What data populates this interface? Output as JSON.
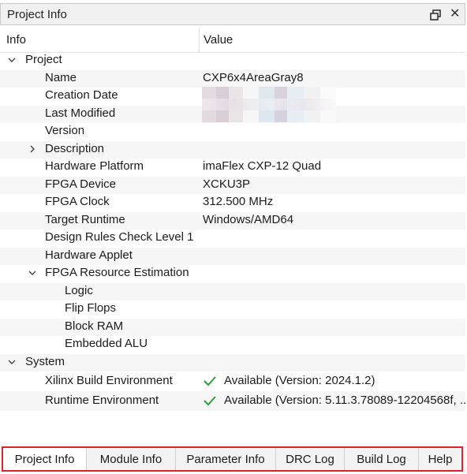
{
  "panel": {
    "title": "Project Info"
  },
  "header": {
    "info_label": "Info",
    "value_label": "Value"
  },
  "tree": {
    "project_label": "Project",
    "name": {
      "label": "Name",
      "value": "CXP6x4AreaGray8"
    },
    "creation_date": {
      "label": "Creation Date"
    },
    "last_modified": {
      "label": "Last Modified"
    },
    "version": {
      "label": "Version"
    },
    "description": {
      "label": "Description"
    },
    "hardware_platform": {
      "label": "Hardware Platform",
      "value": "imaFlex CXP-12 Quad"
    },
    "fpga_device": {
      "label": "FPGA Device",
      "value": "XCKU3P"
    },
    "fpga_clock": {
      "label": "FPGA Clock",
      "value": "312.500 MHz"
    },
    "target_runtime": {
      "label": "Target Runtime",
      "value": "Windows/AMD64"
    },
    "drc_level": {
      "label": "Design Rules Check Level 1"
    },
    "hardware_applet": {
      "label": "Hardware Applet"
    },
    "fpga_resource": {
      "label": "FPGA Resource Estimation"
    },
    "logic": {
      "label": "Logic"
    },
    "flip_flops": {
      "label": "Flip Flops"
    },
    "block_ram": {
      "label": "Block RAM"
    },
    "embedded_alu": {
      "label": "Embedded ALU"
    },
    "system_label": "System",
    "xilinx_env": {
      "label": "Xilinx Build Environment",
      "value": "Available (Version: 2024.1.2)"
    },
    "runtime_env": {
      "label": "Runtime Environment",
      "value": "Available (Version: 5.11.3.78089-12204568f, ..."
    }
  },
  "tabs": {
    "project_info": "Project Info",
    "module_info": "Module Info",
    "parameter_info": "Parameter Info",
    "drc_log": "DRC Log",
    "build_log": "Build Log",
    "help": "Help"
  },
  "colors": {
    "check_green": "#2e9e3f",
    "tab_highlight": "#d9242b"
  }
}
